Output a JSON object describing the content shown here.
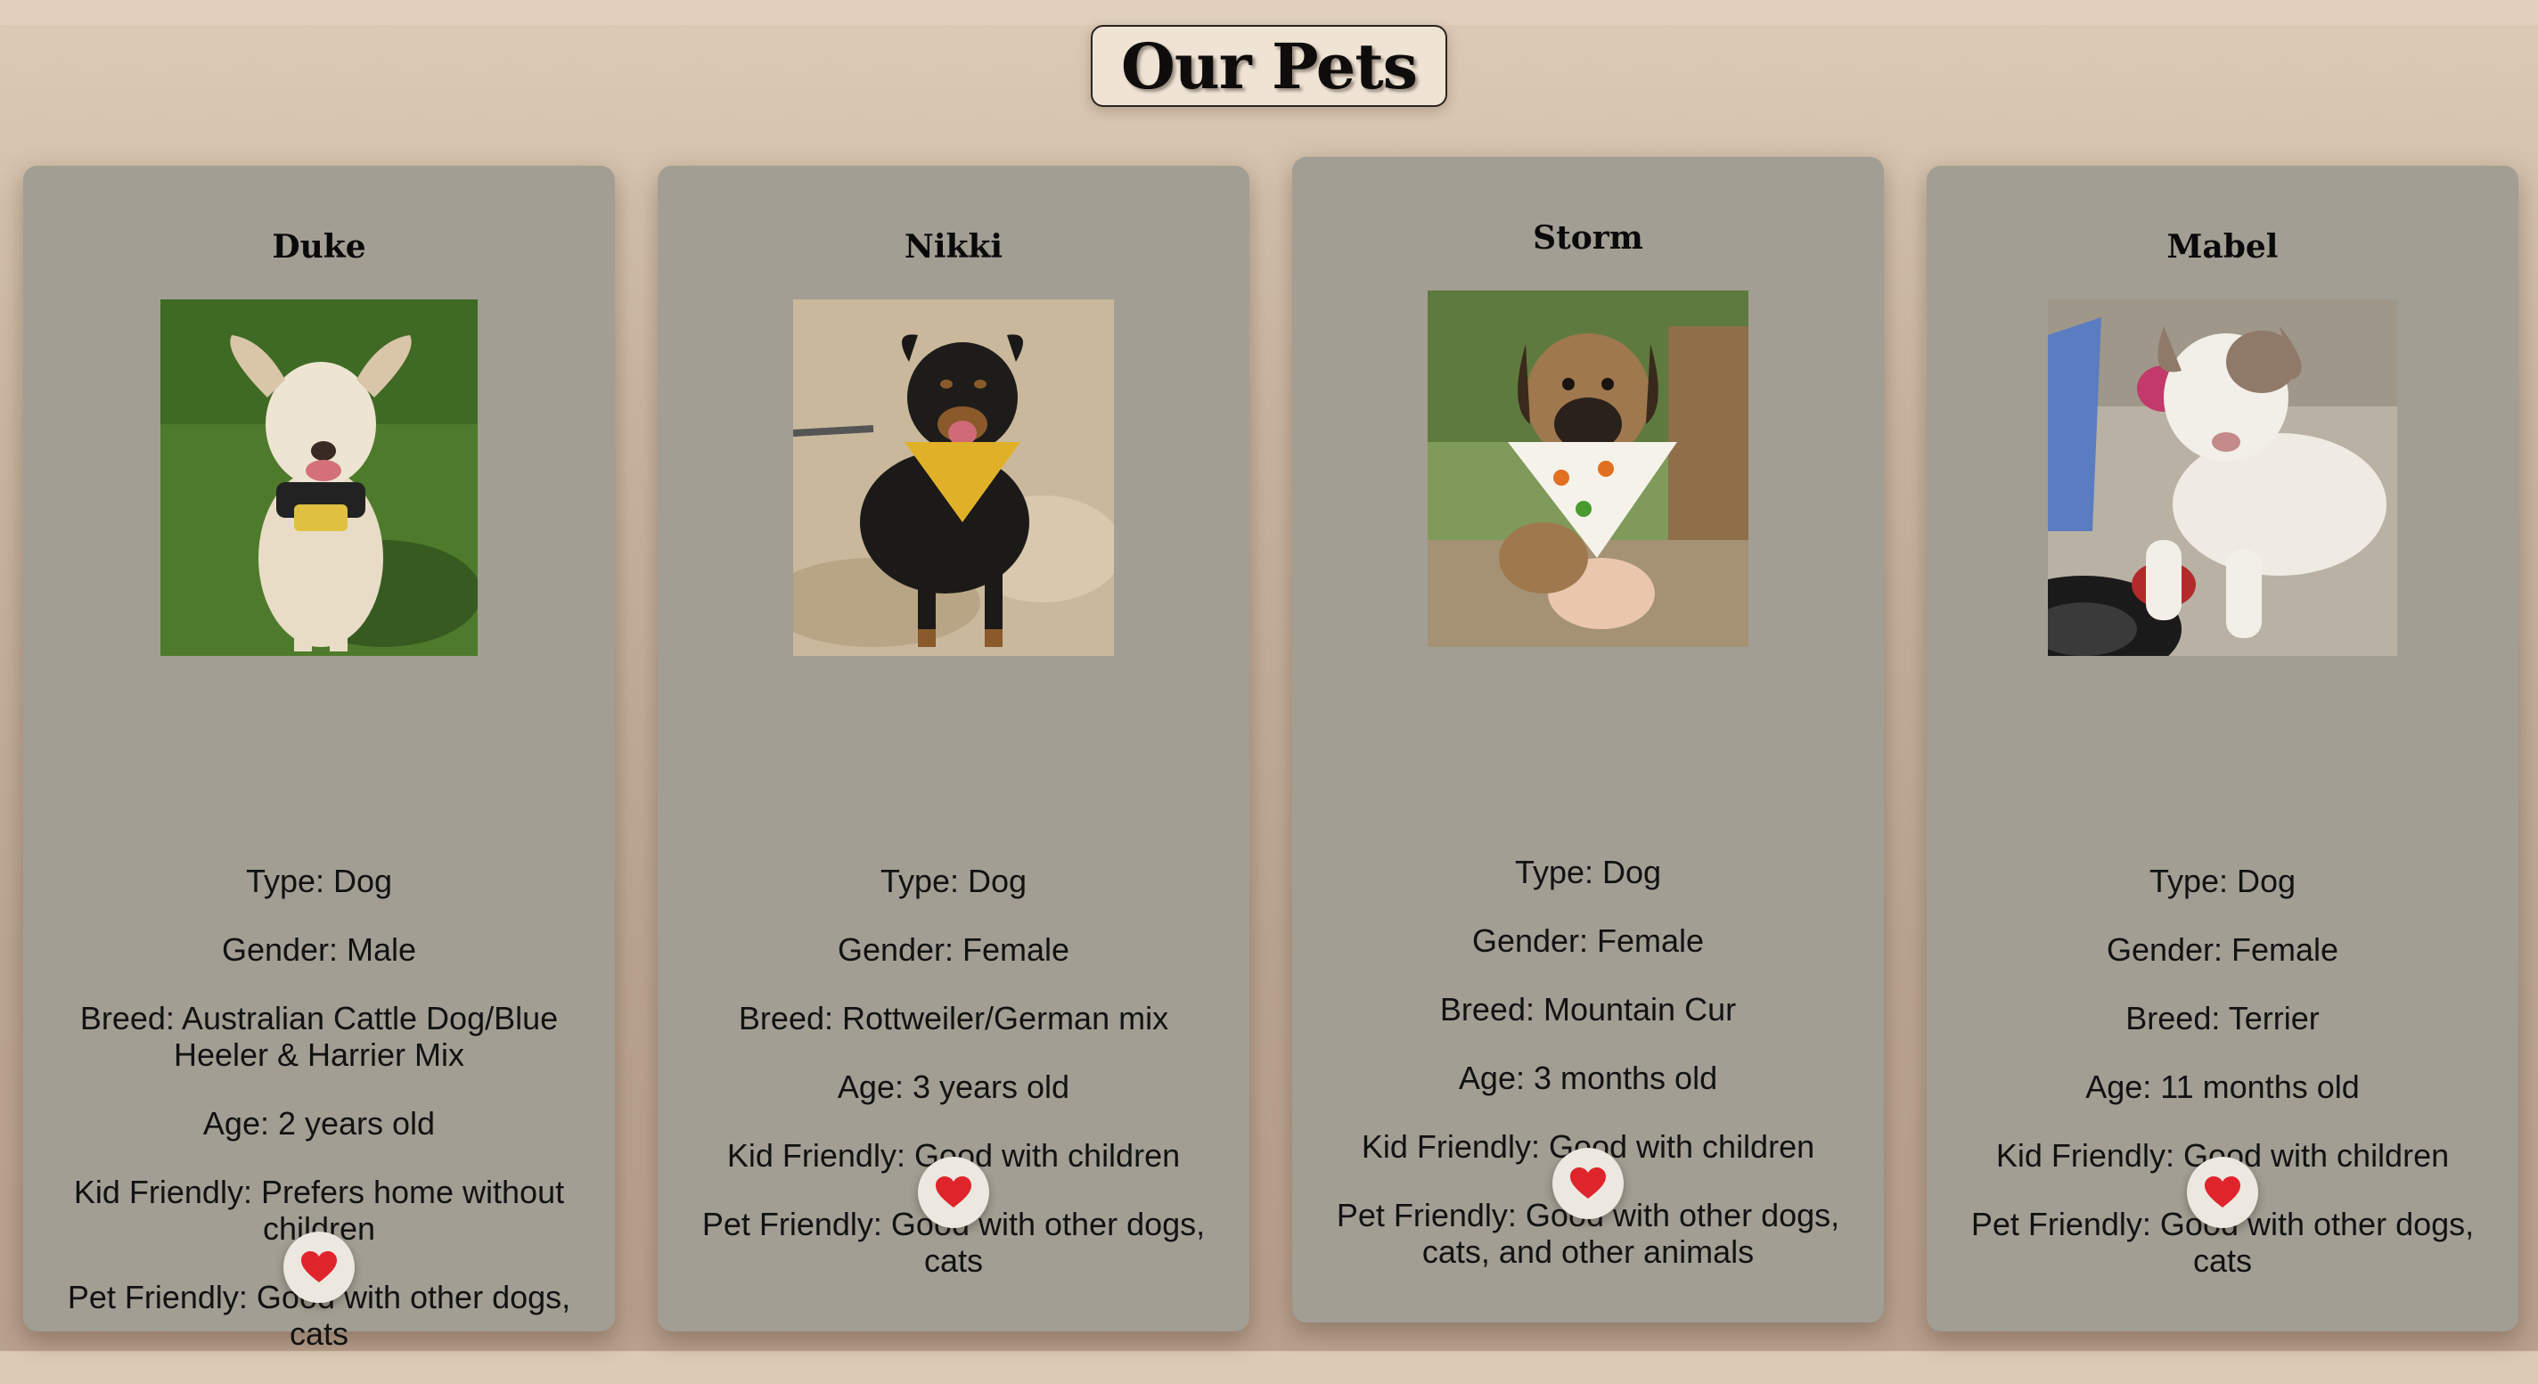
{
  "page": {
    "title": "Our Pets"
  },
  "pets": [
    {
      "name": "Duke",
      "photo_alt": "Duke",
      "type": "Type: Dog",
      "gender": "Gender: Male",
      "breed": "Breed: Australian Cattle Dog/Blue Heeler & Harrier Mix",
      "age": "Age: 2 years old",
      "kid_friendly": "Kid Friendly: Prefers home without children",
      "pet_friendly": "Pet Friendly: Good with other dogs, cats"
    },
    {
      "name": "Nikki",
      "photo_alt": "Nikki",
      "type": "Type: Dog",
      "gender": "Gender: Female",
      "breed": "Breed: Rottweiler/German mix",
      "age": "Age: 3 years old",
      "kid_friendly": "Kid Friendly: Good with children",
      "pet_friendly": "Pet Friendly: Good with other dogs, cats"
    },
    {
      "name": "Storm",
      "photo_alt": "Storm",
      "type": "Type: Dog",
      "gender": "Gender: Female",
      "breed": "Breed: Mountain Cur",
      "age": "Age: 3 months old",
      "kid_friendly": "Kid Friendly: Good with children",
      "pet_friendly": "Pet Friendly: Good with other dogs, cats, and other animals"
    },
    {
      "name": "Mabel",
      "photo_alt": "Mabel",
      "type": "Type: Dog",
      "gender": "Gender: Female",
      "breed": "Breed: Terrier",
      "age": "Age: 11 months old",
      "kid_friendly": "Kid Friendly: Good with children",
      "pet_friendly": "Pet Friendly: Good with other dogs, cats"
    }
  ],
  "icons": {
    "favorite": "heart-icon"
  },
  "colors": {
    "heart": "#e0242b",
    "card": "#a29e94",
    "title_bg": "#efe3d4"
  }
}
